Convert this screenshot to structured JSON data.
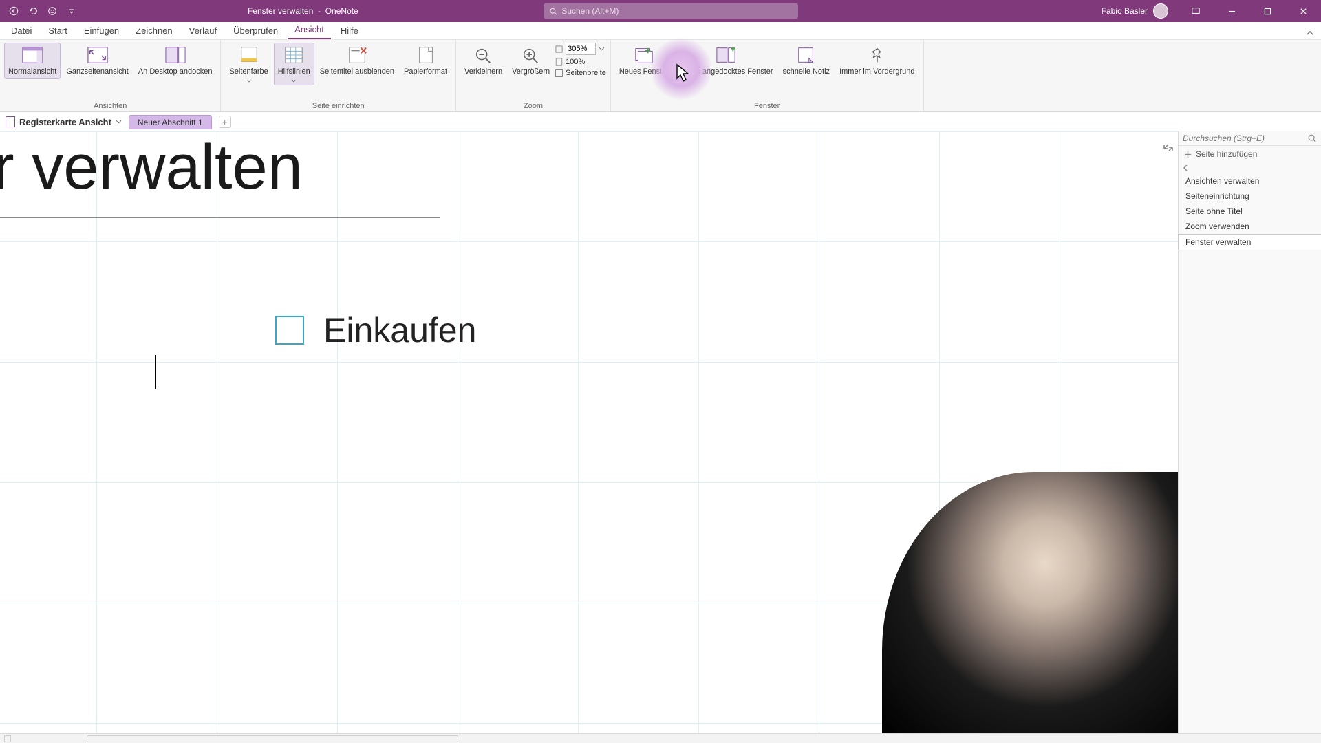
{
  "titlebar": {
    "doc_title": "Fenster verwalten",
    "app_name": "OneNote",
    "search_placeholder": "Suchen (Alt+M)",
    "user_name": "Fabio Basler"
  },
  "menu": {
    "tabs": [
      "Datei",
      "Start",
      "Einfügen",
      "Zeichnen",
      "Verlauf",
      "Überprüfen",
      "Ansicht",
      "Hilfe"
    ],
    "active_index": 6
  },
  "ribbon": {
    "groups": {
      "ansichten": {
        "label": "Ansichten",
        "normal": "Normalansicht",
        "ganzseite": "Ganzseitenansicht",
        "dock": "An Desktop andocken"
      },
      "seite": {
        "label": "Seite einrichten",
        "seitenfarbe": "Seitenfarbe",
        "hilfslinien": "Hilfslinien",
        "seitentitel": "Seitentitel ausblenden",
        "papier": "Papierformat"
      },
      "zoom": {
        "label": "Zoom",
        "verkleinern": "Verkleinern",
        "vergroessern": "Vergrößern",
        "value": "305%",
        "hundred": "100%",
        "breite": "Seitenbreite"
      },
      "fenster": {
        "label": "Fenster",
        "neues": "Neues Fenster",
        "angedockt": "Neues angedocktes Fenster",
        "schnell": "schnelle Notiz",
        "vordergrund": "Immer im Vordergrund"
      }
    }
  },
  "notebook": {
    "name": "Registerkarte Ansicht",
    "section": "Neuer Abschnitt 1"
  },
  "page": {
    "title_fragment": "r verwalten",
    "todo_text": "Einkaufen"
  },
  "pagepanel": {
    "search_placeholder": "Durchsuchen (Strg+E)",
    "add_page": "Seite hinzufügen",
    "pages": [
      "Ansichten verwalten",
      "Seiteneinrichtung",
      "Seite ohne Titel",
      "Zoom verwenden",
      "Fenster verwalten"
    ],
    "active_index": 4
  }
}
